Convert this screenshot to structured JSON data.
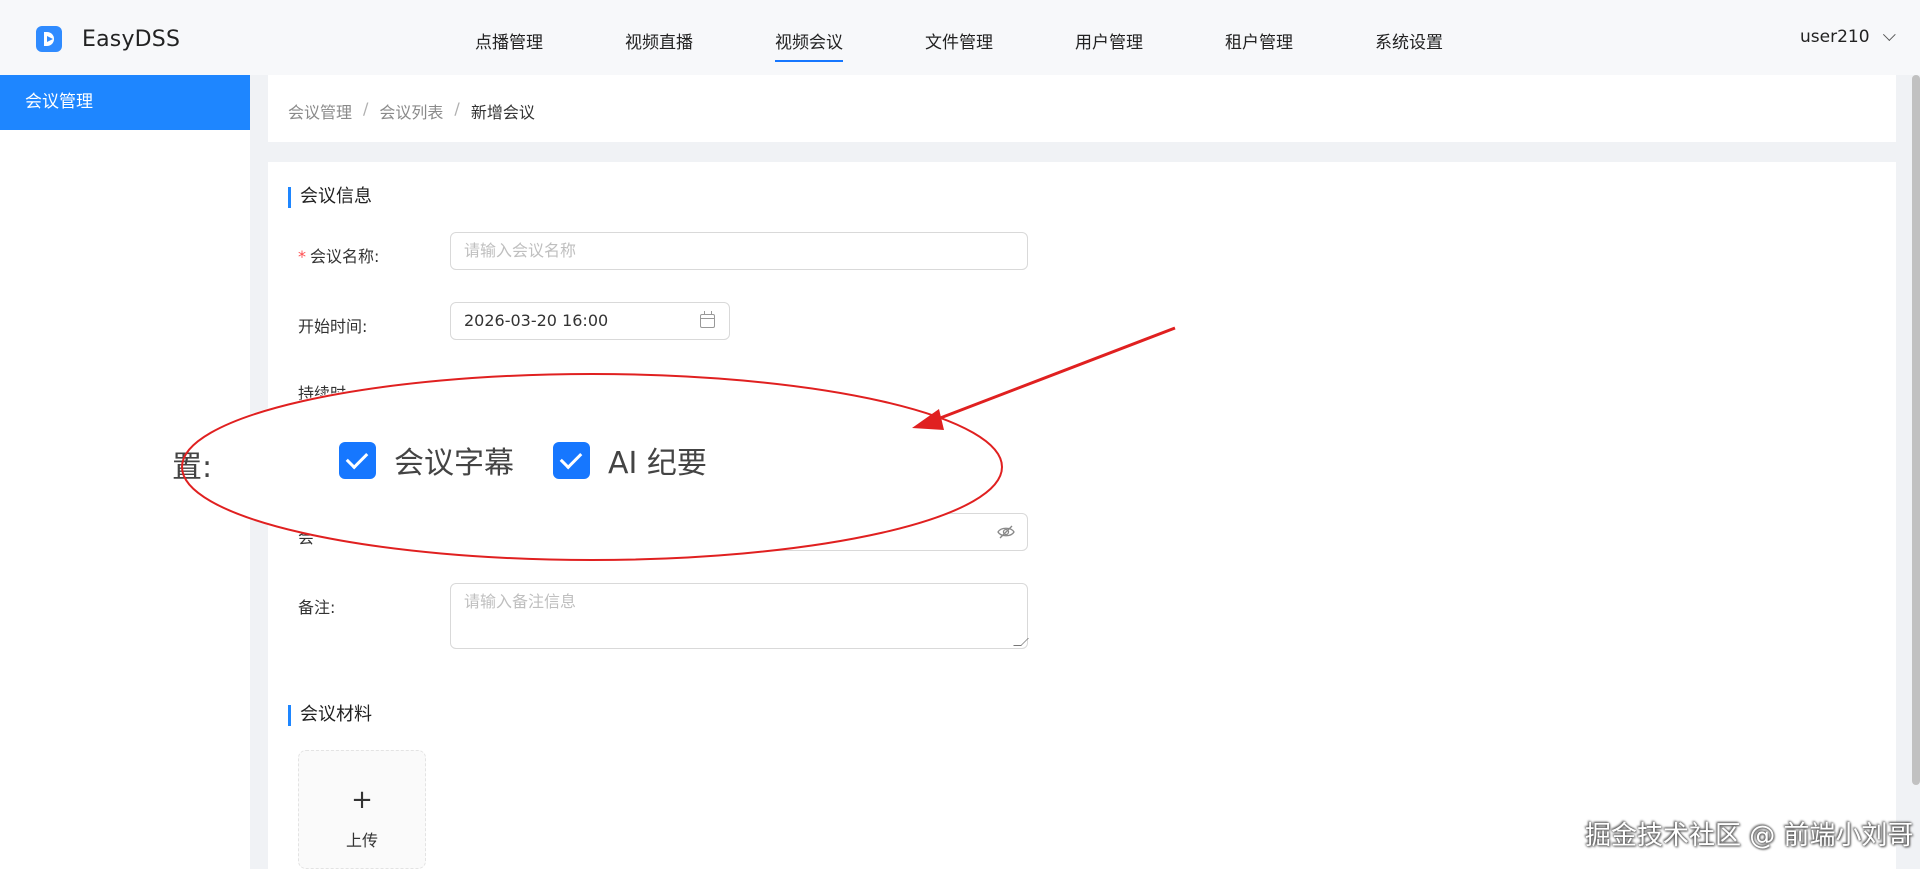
{
  "app": {
    "name": "EasyDSS"
  },
  "nav": {
    "items": [
      "点播管理",
      "视频直播",
      "视频会议",
      "文件管理",
      "用户管理",
      "租户管理",
      "系统设置"
    ],
    "active": "视频会议"
  },
  "user": {
    "name": "user210"
  },
  "sidebar": {
    "items": [
      {
        "label": "会议管理",
        "active": true
      }
    ]
  },
  "breadcrumb": [
    "会议管理",
    "会议列表",
    "新增会议"
  ],
  "breadcrumb_sep": "/",
  "form": {
    "section_info": "会议信息",
    "name_label": "会议名称:",
    "name_required_mark": "*",
    "name_placeholder": "请输入会议名称",
    "start_label": "开始时间:",
    "start_value": "2026-03-20 16:00",
    "duration_label_partial": "持续时",
    "password_label_partial": "会",
    "remark_label": "备注:",
    "remark_placeholder": "请输入备注信息",
    "section_material": "会议材料",
    "upload_plus": "+",
    "upload_label": "上传"
  },
  "annotation": {
    "zoom_label_partial": "置:",
    "options": [
      {
        "label": "会议字幕",
        "checked": true
      },
      {
        "label": "AI 纪要",
        "checked": true
      }
    ],
    "circle_color": "#e02020",
    "arrow_color": "#e02020"
  },
  "watermark": "掘金技术社区 @ 前端小刘哥",
  "colors": {
    "primary": "#1e86ff",
    "required": "#ff4d4f"
  }
}
